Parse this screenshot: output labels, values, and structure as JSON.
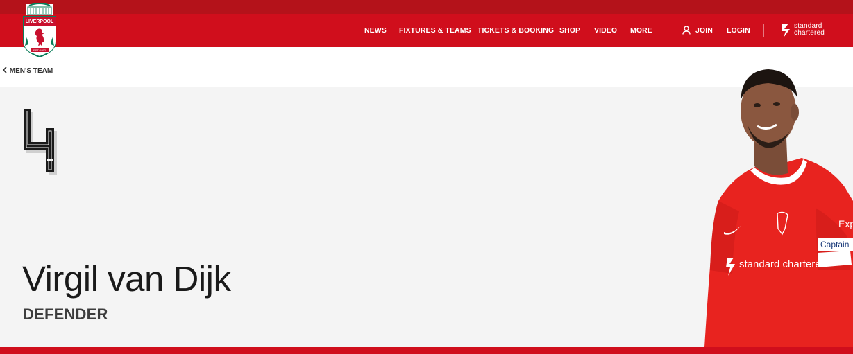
{
  "header": {
    "logo": {
      "icon": "liverpool-fc-crest",
      "text": "LIVERPOOL",
      "motto": "YOU'LL NEVER WALK ALONE",
      "est": "EST·1892"
    },
    "nav": {
      "news": "NEWS",
      "fixtures_teams": "FIXTURES & TEAMS",
      "tickets_booking": "TICKETS & BOOKING",
      "shop": "SHOP",
      "video": "VIDEO",
      "more": "MORE",
      "join": "JOIN",
      "login": "LOGIN"
    },
    "sponsor": {
      "icon": "standard-chartered-logo",
      "line1": "standard",
      "line2": "chartered"
    }
  },
  "breadcrumb": {
    "icon": "chevron-left-icon",
    "label": "MEN'S TEAM"
  },
  "player": {
    "number": "4",
    "name": "Virgil van Dijk",
    "position": "DEFENDER",
    "image": "player-photo",
    "shirt_sponsor": "standard chartered",
    "armband": "Captain",
    "sleeve_text": "Exp"
  },
  "colors": {
    "brand_red": "#d00e1c",
    "top_strip": "#b4121a",
    "hero_bg": "#f4f4f4",
    "name_text": "#1a1a1a",
    "position_text": "#3d3d3d"
  }
}
